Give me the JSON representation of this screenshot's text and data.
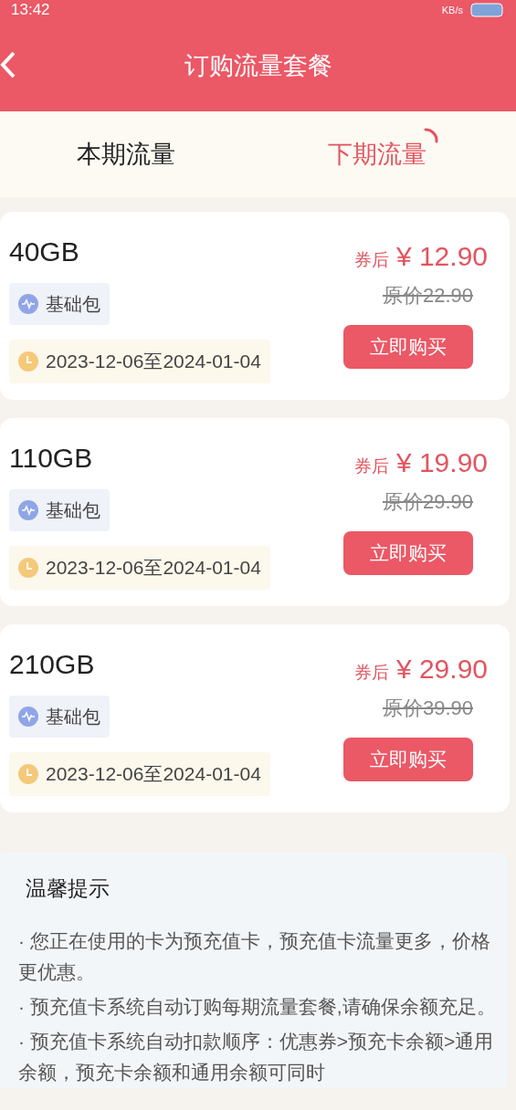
{
  "status_bar": {
    "time": "13:42",
    "speed": "KB/s"
  },
  "header": {
    "title": "订购流量套餐"
  },
  "tabs": [
    {
      "label": "本期流量",
      "selected": false
    },
    {
      "label": "下期流量",
      "selected": true
    }
  ],
  "packages": [
    {
      "size": "40GB",
      "tag": "基础包",
      "period": "2023-12-06至2024-01-04",
      "coupon_label": "券后",
      "price": "¥ 12.90",
      "original": "原价22.90",
      "button": "立即购买"
    },
    {
      "size": "110GB",
      "tag": "基础包",
      "period": "2023-12-06至2024-01-04",
      "coupon_label": "券后",
      "price": "¥ 19.90",
      "original": "原价29.90",
      "button": "立即购买"
    },
    {
      "size": "210GB",
      "tag": "基础包",
      "period": "2023-12-06至2024-01-04",
      "coupon_label": "券后",
      "price": "¥ 29.90",
      "original": "原价39.90",
      "button": "立即购买"
    }
  ],
  "tips": {
    "title": "温馨提示",
    "items": [
      "·  您正在使用的卡为预充值卡，预充值卡流量更多，价格更优惠。",
      "·  预充值卡系统自动订购每期流量套餐,请确保余额充足。",
      "·  预充值卡系统自动扣款顺序：优惠券>预充卡余额>通用余额，预充卡余额和通用余额可同时"
    ]
  }
}
